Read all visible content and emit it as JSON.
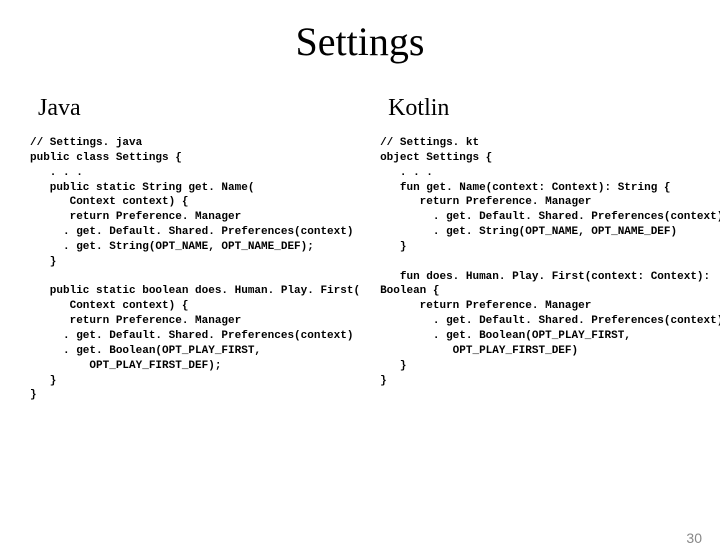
{
  "title": "Settings",
  "left": {
    "header": "Java",
    "code": "// Settings. java\npublic class Settings {\n   . . .\n   public static String get. Name(\n      Context context) {\n      return Preference. Manager\n     . get. Default. Shared. Preferences(context)\n     . get. String(OPT_NAME, OPT_NAME_DEF);\n   }\n\n   public static boolean does. Human. Play. First(\n      Context context) {\n      return Preference. Manager\n     . get. Default. Shared. Preferences(context)\n     . get. Boolean(OPT_PLAY_FIRST,\n         OPT_PLAY_FIRST_DEF);\n   }\n}"
  },
  "right": {
    "header": "Kotlin",
    "code": "// Settings. kt\nobject Settings {\n   . . .\n   fun get. Name(context: Context): String {\n      return Preference. Manager\n        . get. Default. Shared. Preferences(context)\n        . get. String(OPT_NAME, OPT_NAME_DEF)\n   }\n\n   fun does. Human. Play. First(context: Context):\nBoolean {\n      return Preference. Manager\n        . get. Default. Shared. Preferences(context)\n        . get. Boolean(OPT_PLAY_FIRST,\n           OPT_PLAY_FIRST_DEF)\n   }\n}"
  },
  "page_number": "30"
}
